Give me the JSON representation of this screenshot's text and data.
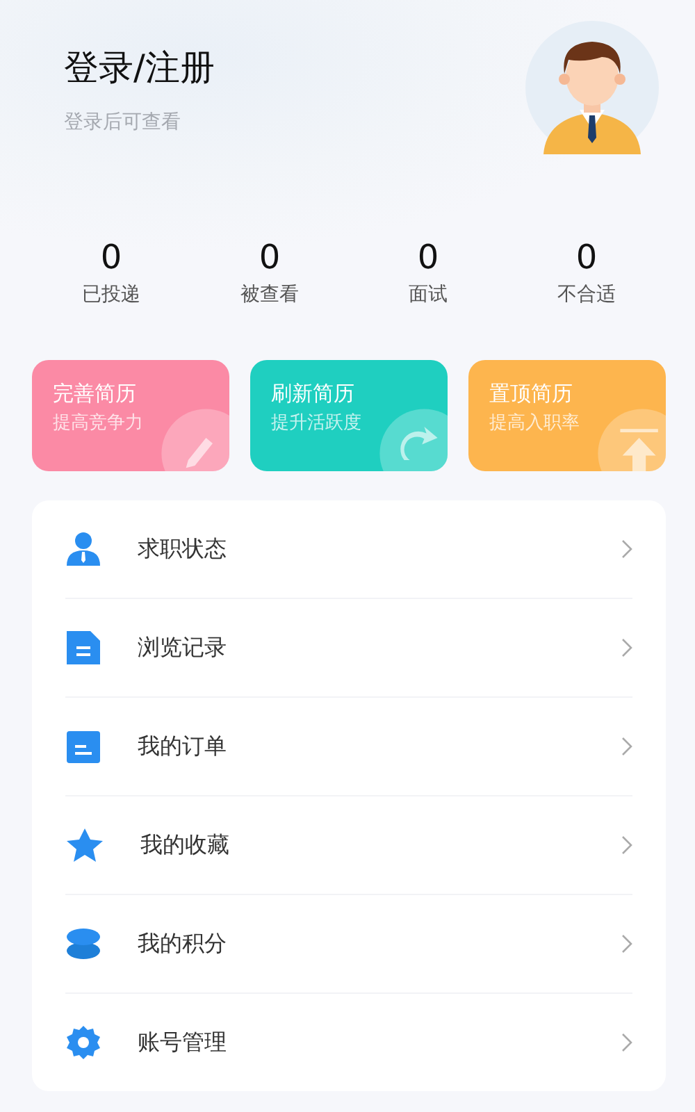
{
  "header": {
    "title": "登录/注册",
    "subtitle": "登录后可查看"
  },
  "stats": [
    {
      "value": "0",
      "label": "已投递"
    },
    {
      "value": "0",
      "label": "被查看"
    },
    {
      "value": "0",
      "label": "面试"
    },
    {
      "value": "0",
      "label": "不合适"
    }
  ],
  "resume_cards": [
    {
      "title": "完善简历",
      "subtitle": "提高竞争力",
      "kind": "edit",
      "color": "#fb8aa5"
    },
    {
      "title": "刷新简历",
      "subtitle": "提升活跃度",
      "kind": "refresh",
      "color": "#1fcfc0"
    },
    {
      "title": "置顶简历",
      "subtitle": "提高入职率",
      "kind": "top",
      "color": "#fdb54e"
    }
  ],
  "menu": [
    {
      "label": "求职状态",
      "kind": "person"
    },
    {
      "label": "浏览记录",
      "kind": "document"
    },
    {
      "label": "我的订单",
      "kind": "clipboard"
    },
    {
      "label": "我的收藏",
      "kind": "star"
    },
    {
      "label": "我的积分",
      "kind": "coins"
    },
    {
      "label": "账号管理",
      "kind": "gear"
    }
  ]
}
